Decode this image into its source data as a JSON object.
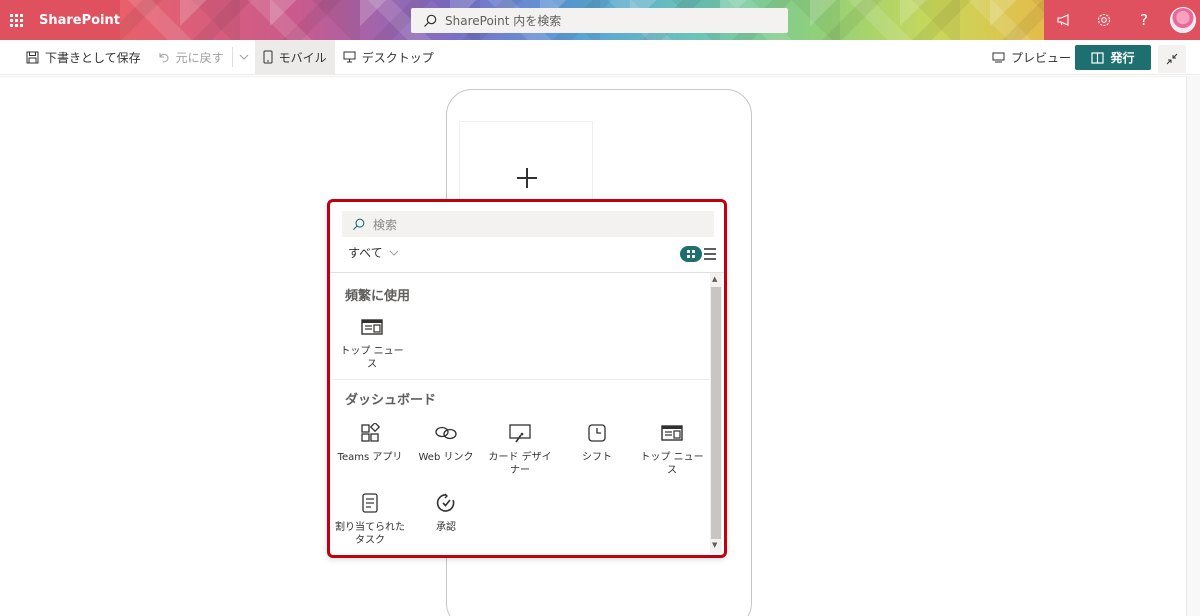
{
  "suite": {
    "brand": "SharePoint",
    "search_placeholder": "SharePoint 内を検索"
  },
  "commands": {
    "save_draft": "下書きとして保存",
    "undo": "元に戻す",
    "mobile": "モバイル",
    "desktop": "デスクトップ",
    "preview": "プレビュー",
    "publish": "発行"
  },
  "toolbox": {
    "search_placeholder": "検索",
    "filter": "すべて",
    "sections": [
      {
        "title": "頻繁に使用",
        "items": [
          {
            "label": "トップ ニュース",
            "icon": "news-icon"
          }
        ]
      },
      {
        "title": "ダッシュボード",
        "items": [
          {
            "label": "Teams アプリ",
            "icon": "apps-icon"
          },
          {
            "label": "Web リンク",
            "icon": "link-icon"
          },
          {
            "label": "カード デザイナー",
            "icon": "card-designer-icon"
          },
          {
            "label": "シフト",
            "icon": "clock-icon"
          },
          {
            "label": "トップ ニュース",
            "icon": "news-icon"
          },
          {
            "label": "割り当てられたタスク",
            "icon": "task-list-icon"
          },
          {
            "label": "承認",
            "icon": "approval-icon"
          }
        ]
      }
    ]
  }
}
